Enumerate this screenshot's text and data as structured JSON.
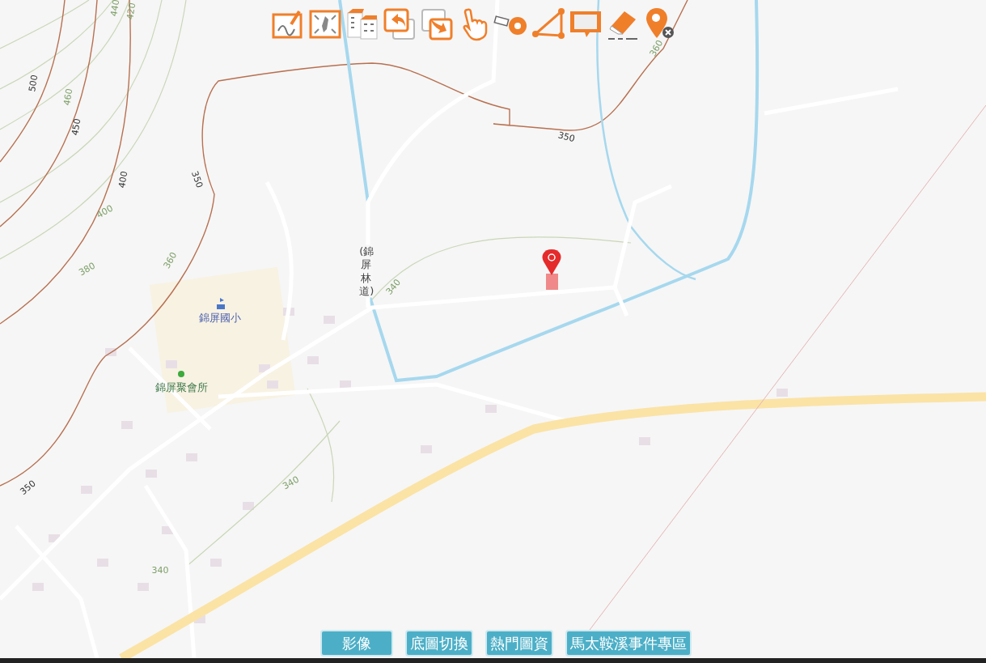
{
  "map": {
    "labels": [
      {
        "kind": "road",
        "text": "(錦屏林道)"
      },
      {
        "kind": "school",
        "text": "錦屏國小"
      },
      {
        "kind": "hall",
        "text": "錦屏聚會所"
      },
      {
        "kind": "contour-index",
        "text": "500"
      },
      {
        "kind": "contour-index",
        "text": "450"
      },
      {
        "kind": "contour-index",
        "text": "400"
      },
      {
        "kind": "contour-index",
        "text": "350"
      },
      {
        "kind": "contour-index",
        "text": "350"
      },
      {
        "kind": "contour-index",
        "text": "350"
      },
      {
        "kind": "contour",
        "text": "460"
      },
      {
        "kind": "contour",
        "text": "440"
      },
      {
        "kind": "contour",
        "text": "420"
      },
      {
        "kind": "contour",
        "text": "400"
      },
      {
        "kind": "contour",
        "text": "380"
      },
      {
        "kind": "contour",
        "text": "360"
      },
      {
        "kind": "contour",
        "text": "340"
      },
      {
        "kind": "contour",
        "text": "340"
      },
      {
        "kind": "contour",
        "text": "340"
      },
      {
        "kind": "contour",
        "text": "360"
      }
    ]
  },
  "buttons": [
    {
      "label": "影像"
    },
    {
      "label": "底圖切換"
    },
    {
      "label": "熱門圖資"
    },
    {
      "label": "馬太鞍溪事件專區"
    }
  ]
}
